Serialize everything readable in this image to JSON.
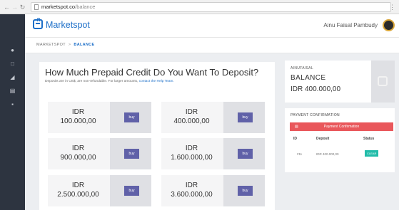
{
  "browser": {
    "url_host": "marketspot.co",
    "url_path": "/balance"
  },
  "header": {
    "brand": "Marketspot",
    "user_name": "Ainu Faisal Pambudy"
  },
  "breadcrumb": {
    "root": "MARKETSPOT",
    "separator": ">",
    "current": "BALANCE"
  },
  "deposit": {
    "title": "How Much Prepaid Credit Do You Want To Deposit?",
    "subtitle": "Deposits are in US$, are non-refundable. For larger amounts,",
    "subtitle_link": "contact the Help Team.",
    "buy_label": "buy",
    "options": [
      {
        "currency": "IDR",
        "amount": "100.000,00"
      },
      {
        "currency": "IDR",
        "amount": "400.000,00"
      },
      {
        "currency": "IDR",
        "amount": "900.000,00"
      },
      {
        "currency": "IDR",
        "amount": "1.600.000,00"
      },
      {
        "currency": "IDR",
        "amount": "2.500.000,00"
      },
      {
        "currency": "IDR",
        "amount": "3.600.000,00"
      }
    ]
  },
  "balance": {
    "user": "AINUFAISAL",
    "label": "BALANCE",
    "amount": "IDR 400.000,00"
  },
  "payment": {
    "title": "PAYMENT CONFIRMATION",
    "button_label": "Payment Confirmation",
    "columns": [
      "ID",
      "Deposit",
      "Status"
    ],
    "rows": [
      {
        "id": "#11",
        "deposit": "IDR 400.000,00",
        "status": "CLEAR"
      }
    ]
  },
  "colors": {
    "brand": "#1d6fc8",
    "sidebar": "#2d3440",
    "buy_button": "#6061a8",
    "confirm_button": "#e9575b",
    "status_clear": "#22bca9"
  },
  "icons": {
    "sidebar": [
      "user-icon",
      "document-icon",
      "chart-icon",
      "inbox-icon",
      "stats-icon"
    ]
  }
}
